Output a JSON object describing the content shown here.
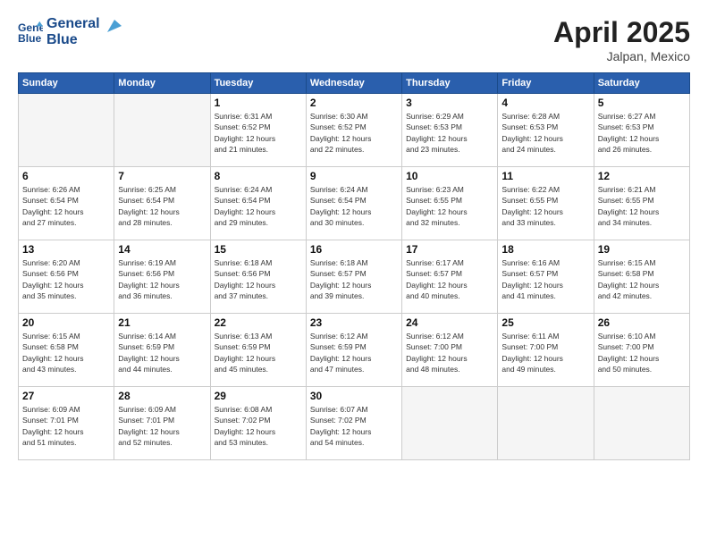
{
  "logo": {
    "line1": "General",
    "line2": "Blue"
  },
  "title": "April 2025",
  "subtitle": "Jalpan, Mexico",
  "days_header": [
    "Sunday",
    "Monday",
    "Tuesday",
    "Wednesday",
    "Thursday",
    "Friday",
    "Saturday"
  ],
  "weeks": [
    [
      {
        "day": "",
        "info": ""
      },
      {
        "day": "",
        "info": ""
      },
      {
        "day": "1",
        "info": "Sunrise: 6:31 AM\nSunset: 6:52 PM\nDaylight: 12 hours\nand 21 minutes."
      },
      {
        "day": "2",
        "info": "Sunrise: 6:30 AM\nSunset: 6:52 PM\nDaylight: 12 hours\nand 22 minutes."
      },
      {
        "day": "3",
        "info": "Sunrise: 6:29 AM\nSunset: 6:53 PM\nDaylight: 12 hours\nand 23 minutes."
      },
      {
        "day": "4",
        "info": "Sunrise: 6:28 AM\nSunset: 6:53 PM\nDaylight: 12 hours\nand 24 minutes."
      },
      {
        "day": "5",
        "info": "Sunrise: 6:27 AM\nSunset: 6:53 PM\nDaylight: 12 hours\nand 26 minutes."
      }
    ],
    [
      {
        "day": "6",
        "info": "Sunrise: 6:26 AM\nSunset: 6:54 PM\nDaylight: 12 hours\nand 27 minutes."
      },
      {
        "day": "7",
        "info": "Sunrise: 6:25 AM\nSunset: 6:54 PM\nDaylight: 12 hours\nand 28 minutes."
      },
      {
        "day": "8",
        "info": "Sunrise: 6:24 AM\nSunset: 6:54 PM\nDaylight: 12 hours\nand 29 minutes."
      },
      {
        "day": "9",
        "info": "Sunrise: 6:24 AM\nSunset: 6:54 PM\nDaylight: 12 hours\nand 30 minutes."
      },
      {
        "day": "10",
        "info": "Sunrise: 6:23 AM\nSunset: 6:55 PM\nDaylight: 12 hours\nand 32 minutes."
      },
      {
        "day": "11",
        "info": "Sunrise: 6:22 AM\nSunset: 6:55 PM\nDaylight: 12 hours\nand 33 minutes."
      },
      {
        "day": "12",
        "info": "Sunrise: 6:21 AM\nSunset: 6:55 PM\nDaylight: 12 hours\nand 34 minutes."
      }
    ],
    [
      {
        "day": "13",
        "info": "Sunrise: 6:20 AM\nSunset: 6:56 PM\nDaylight: 12 hours\nand 35 minutes."
      },
      {
        "day": "14",
        "info": "Sunrise: 6:19 AM\nSunset: 6:56 PM\nDaylight: 12 hours\nand 36 minutes."
      },
      {
        "day": "15",
        "info": "Sunrise: 6:18 AM\nSunset: 6:56 PM\nDaylight: 12 hours\nand 37 minutes."
      },
      {
        "day": "16",
        "info": "Sunrise: 6:18 AM\nSunset: 6:57 PM\nDaylight: 12 hours\nand 39 minutes."
      },
      {
        "day": "17",
        "info": "Sunrise: 6:17 AM\nSunset: 6:57 PM\nDaylight: 12 hours\nand 40 minutes."
      },
      {
        "day": "18",
        "info": "Sunrise: 6:16 AM\nSunset: 6:57 PM\nDaylight: 12 hours\nand 41 minutes."
      },
      {
        "day": "19",
        "info": "Sunrise: 6:15 AM\nSunset: 6:58 PM\nDaylight: 12 hours\nand 42 minutes."
      }
    ],
    [
      {
        "day": "20",
        "info": "Sunrise: 6:15 AM\nSunset: 6:58 PM\nDaylight: 12 hours\nand 43 minutes."
      },
      {
        "day": "21",
        "info": "Sunrise: 6:14 AM\nSunset: 6:59 PM\nDaylight: 12 hours\nand 44 minutes."
      },
      {
        "day": "22",
        "info": "Sunrise: 6:13 AM\nSunset: 6:59 PM\nDaylight: 12 hours\nand 45 minutes."
      },
      {
        "day": "23",
        "info": "Sunrise: 6:12 AM\nSunset: 6:59 PM\nDaylight: 12 hours\nand 47 minutes."
      },
      {
        "day": "24",
        "info": "Sunrise: 6:12 AM\nSunset: 7:00 PM\nDaylight: 12 hours\nand 48 minutes."
      },
      {
        "day": "25",
        "info": "Sunrise: 6:11 AM\nSunset: 7:00 PM\nDaylight: 12 hours\nand 49 minutes."
      },
      {
        "day": "26",
        "info": "Sunrise: 6:10 AM\nSunset: 7:00 PM\nDaylight: 12 hours\nand 50 minutes."
      }
    ],
    [
      {
        "day": "27",
        "info": "Sunrise: 6:09 AM\nSunset: 7:01 PM\nDaylight: 12 hours\nand 51 minutes."
      },
      {
        "day": "28",
        "info": "Sunrise: 6:09 AM\nSunset: 7:01 PM\nDaylight: 12 hours\nand 52 minutes."
      },
      {
        "day": "29",
        "info": "Sunrise: 6:08 AM\nSunset: 7:02 PM\nDaylight: 12 hours\nand 53 minutes."
      },
      {
        "day": "30",
        "info": "Sunrise: 6:07 AM\nSunset: 7:02 PM\nDaylight: 12 hours\nand 54 minutes."
      },
      {
        "day": "",
        "info": ""
      },
      {
        "day": "",
        "info": ""
      },
      {
        "day": "",
        "info": ""
      }
    ]
  ]
}
